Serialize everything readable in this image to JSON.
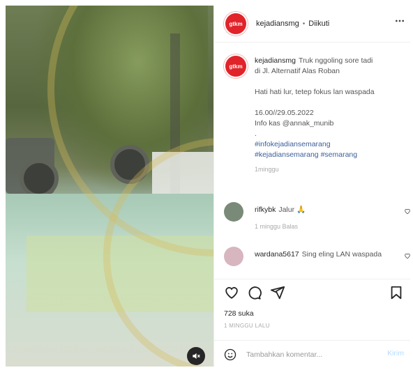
{
  "post": {
    "username": "kejadiansmg",
    "avatar_text": "gtkm",
    "following_dot": "•",
    "following_label": "Diikuti",
    "more_icon": "more-horizontal-icon"
  },
  "caption": {
    "username": "kejadiansmg",
    "lines": [
      "Truk nggoling sore tadi",
      "di Jl. Alternatif Alas Roban",
      "",
      "Hati hati lur, tetep fokus lan waspada",
      "",
      "16.00//29.05.2022",
      "Info kas @annak_munib",
      "."
    ],
    "hashtags_line1": "#infokejadiansemarang",
    "hashtags_line2a": "#kejadiansemarang",
    "hashtags_line2b": "#semarang",
    "time": "1minggu"
  },
  "comments": [
    {
      "username": "rifkybk",
      "text": "Jalur 🙏",
      "meta": "1 minggu   Balas",
      "avatar_color": "#7a8a78"
    },
    {
      "username": "wardana5617",
      "text": "Sing eling LAN waspada",
      "meta": "",
      "avatar_color": "#d7b6c0"
    }
  ],
  "actions": {
    "like_icon": "heart-icon",
    "comment_icon": "comment-icon",
    "share_icon": "paper-plane-icon",
    "save_icon": "bookmark-icon"
  },
  "likes_text": "728 suka",
  "ago_text": "1 MINGGU LALU",
  "add_comment": {
    "placeholder": "Tambahkan komentar...",
    "post_label": "Kirim",
    "emoji_icon": "emoji-icon"
  },
  "media": {
    "mute_icon": "speaker-muted-icon"
  },
  "colors": {
    "brand": "#e0242a",
    "hashtag": "#3b5e9a",
    "post_disabled": "#b3dbff"
  }
}
